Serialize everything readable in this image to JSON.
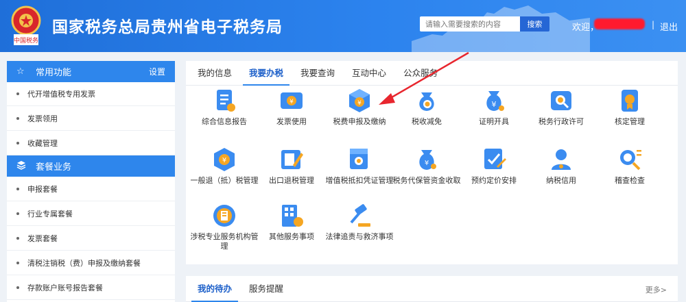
{
  "header": {
    "title": "国家税务总局贵州省电子税务局",
    "emblem_caption": "中国税务",
    "search_placeholder": "请输入需要搜索的内容",
    "search_button": "搜索",
    "welcome": "欢迎，",
    "separator": "|",
    "logout": "退出"
  },
  "sidebar": {
    "sections": [
      {
        "title": "常用功能",
        "action": "设置",
        "icon": "star-icon",
        "items": [
          "代开增值税专用发票",
          "发票领用",
          "收藏管理"
        ]
      },
      {
        "title": "套餐业务",
        "icon": "layers-icon",
        "items": [
          "申报套餐",
          "行业专属套餐",
          "发票套餐",
          "清税注销税（费）申报及缴纳套餐",
          "存款账户账号报告套餐"
        ]
      }
    ]
  },
  "main": {
    "tabs": [
      {
        "label": "我的信息",
        "active": false
      },
      {
        "label": "我要办税",
        "active": true
      },
      {
        "label": "我要查询",
        "active": false
      },
      {
        "label": "互动中心",
        "active": false
      },
      {
        "label": "公众服务",
        "active": false
      }
    ],
    "services": [
      {
        "label": "综合信息报告",
        "icon": "report-icon"
      },
      {
        "label": "发票使用",
        "icon": "invoice-icon"
      },
      {
        "label": "税费申报及缴纳",
        "icon": "tax-declare-icon"
      },
      {
        "label": "税收减免",
        "icon": "tax-relief-icon"
      },
      {
        "label": "证明开具",
        "icon": "certificate-icon"
      },
      {
        "label": "税务行政许可",
        "icon": "license-icon"
      },
      {
        "label": "核定管理",
        "icon": "approval-icon"
      },
      {
        "label": "一般退（抵）税管理",
        "icon": "refund-icon"
      },
      {
        "label": "出口退税管理",
        "icon": "export-refund-icon"
      },
      {
        "label": "增值税抵扣凭证管理",
        "icon": "vat-voucher-icon"
      },
      {
        "label": "税务代保管资金收取",
        "icon": "fund-custody-icon"
      },
      {
        "label": "预约定价安排",
        "icon": "pricing-icon"
      },
      {
        "label": "纳税信用",
        "icon": "credit-icon"
      },
      {
        "label": "稽查检查",
        "icon": "inspection-icon"
      },
      {
        "label": "涉税专业服务机构管理",
        "icon": "agency-icon"
      },
      {
        "label": "其他服务事项",
        "icon": "other-services-icon"
      },
      {
        "label": "法律追责与救济事项",
        "icon": "legal-icon"
      }
    ]
  },
  "bottom": {
    "tabs": [
      {
        "label": "我的待办",
        "active": true
      },
      {
        "label": "服务提醒",
        "active": false
      }
    ],
    "more": "更多>"
  },
  "colors": {
    "header_blue": "#2c83ee",
    "accent": "#2e86ec",
    "arrow_red": "#e8262e",
    "icon_orange": "#f5a623"
  }
}
